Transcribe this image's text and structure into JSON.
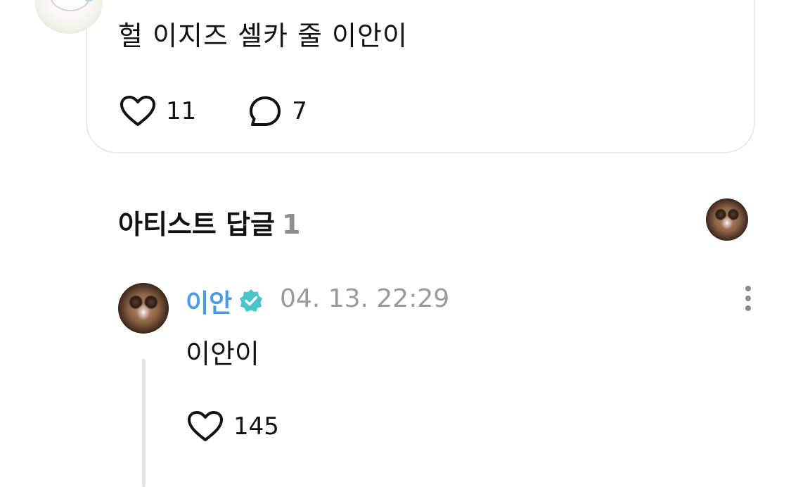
{
  "post": {
    "text": "헐 이지즈 셀카 줄 이안이",
    "like_icon": "heart-outline-icon",
    "like_count": "11",
    "comment_icon": "speech-bubble-icon",
    "comment_count": "7"
  },
  "artist_replies": {
    "title": "아티스트 답글",
    "count": "1"
  },
  "reply": {
    "author": "이안",
    "verified_icon": "verified-badge-icon",
    "verified_color": "#49c5c9",
    "name_color": "#4a9be8",
    "timestamp": "04. 13. 22:29",
    "text": "이안이",
    "like_icon": "heart-outline-icon",
    "like_count": "145",
    "more_icon": "more-vertical-icon"
  }
}
